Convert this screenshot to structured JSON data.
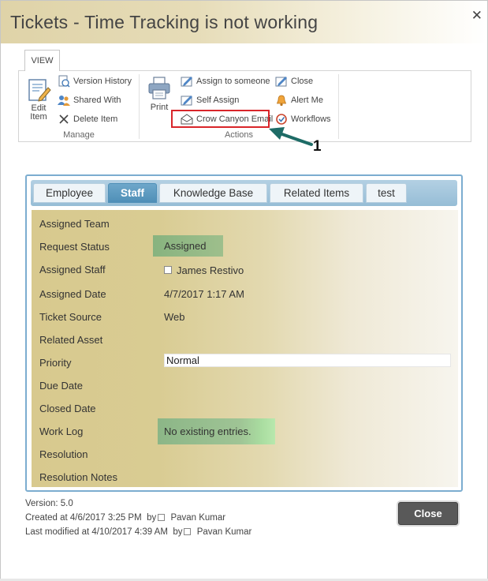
{
  "dialog": {
    "title": "Tickets - Time Tracking is not working",
    "close_glyph": "✕"
  },
  "ribbon": {
    "tab_label": "VIEW",
    "groups": {
      "manage": {
        "label": "Manage",
        "edit_item": "Edit\nItem",
        "version_history": "Version History",
        "shared_with": "Shared With",
        "delete_item": "Delete Item"
      },
      "actions": {
        "label": "Actions",
        "print": "Print",
        "assign_to_someone": "Assign to someone",
        "self_assign": "Self Assign",
        "crow_canyon_email": "Crow Canyon Email",
        "close": "Close",
        "alert_me": "Alert Me",
        "workflows": "Workflows"
      }
    }
  },
  "callout": {
    "number": "1",
    "color": "#1e6b66"
  },
  "form": {
    "tabs": [
      {
        "label": "Employee",
        "active": false
      },
      {
        "label": "Staff",
        "active": true
      },
      {
        "label": "Knowledge Base",
        "active": false
      },
      {
        "label": "Related Items",
        "active": false
      },
      {
        "label": "test",
        "active": false
      }
    ],
    "fields": {
      "assigned_team": {
        "label": "Assigned Team",
        "value": ""
      },
      "request_status": {
        "label": "Request Status",
        "value": "Assigned"
      },
      "assigned_staff": {
        "label": "Assigned Staff",
        "value": "James Restivo"
      },
      "assigned_date": {
        "label": "Assigned Date",
        "value": "4/7/2017 1:17 AM"
      },
      "ticket_source": {
        "label": "Ticket Source",
        "value": "Web"
      },
      "related_asset": {
        "label": "Related Asset",
        "value": ""
      },
      "priority": {
        "label": "Priority",
        "value": "Normal"
      },
      "due_date": {
        "label": "Due Date",
        "value": ""
      },
      "closed_date": {
        "label": "Closed Date",
        "value": ""
      },
      "work_log": {
        "label": "Work Log",
        "value": "No existing entries."
      },
      "resolution": {
        "label": "Resolution",
        "value": ""
      },
      "resolution_notes": {
        "label": "Resolution Notes",
        "value": ""
      }
    }
  },
  "footer": {
    "version": "Version: 5.0",
    "created_at": "Created at 4/6/2017 3:25 PM",
    "created_by_prefix": "by",
    "created_by": "Pavan Kumar",
    "modified_at": "Last modified at 4/10/2017 4:39 AM",
    "modified_by_prefix": "by",
    "modified_by": "Pavan Kumar",
    "close_button": "Close"
  },
  "colors": {
    "title_gradient_start": "#dfd3a8",
    "tab_active": "#4f8fb7",
    "frame_border": "#7cadd0",
    "highlight": "#d9252a",
    "close_button": "#595959"
  }
}
